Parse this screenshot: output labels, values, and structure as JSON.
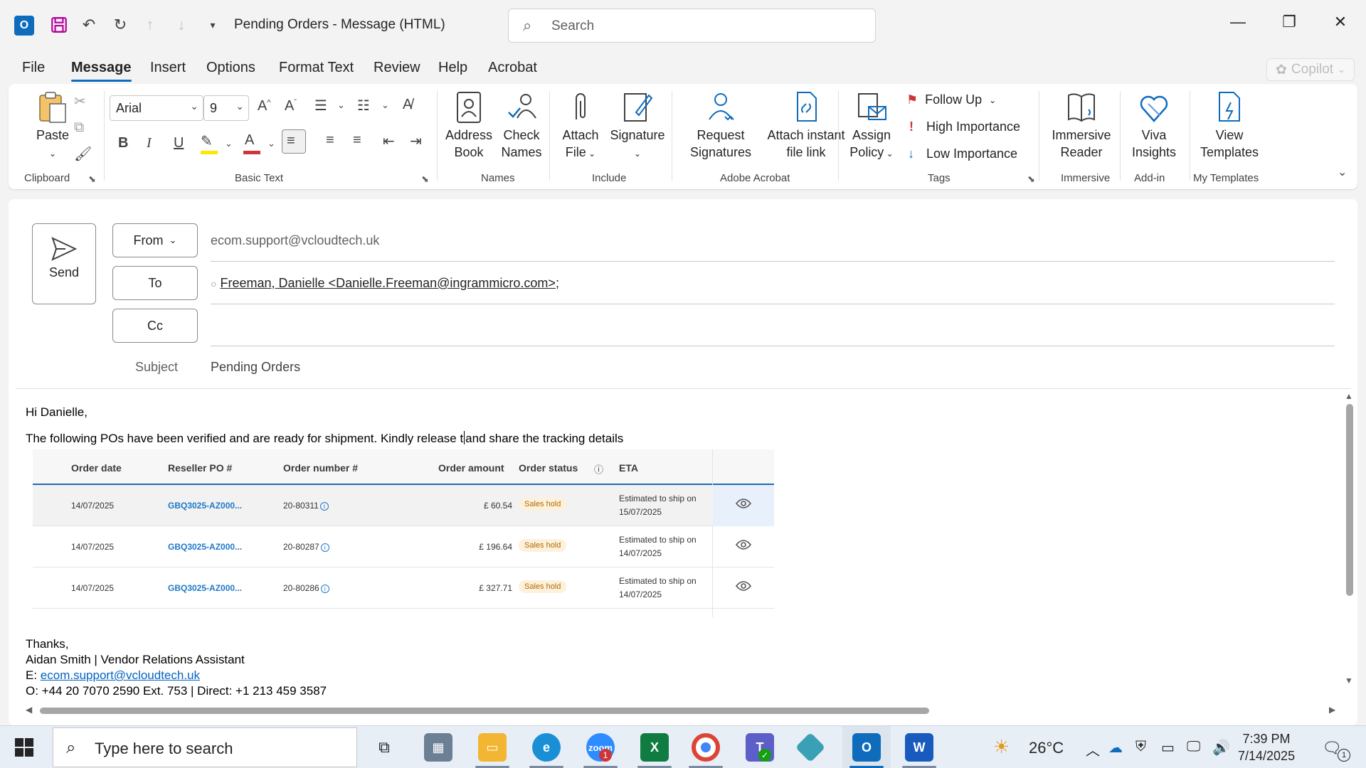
{
  "window": {
    "title": "Pending Orders  -  Message (HTML)",
    "search_placeholder": "Search"
  },
  "menu": {
    "tabs": [
      "File",
      "Message",
      "Insert",
      "Options",
      "Format Text",
      "Review",
      "Help",
      "Acrobat"
    ],
    "active": "Message",
    "copilot_label": "Copilot"
  },
  "ribbon": {
    "clipboard": {
      "paste": "Paste",
      "group": "Clipboard"
    },
    "basic_text": {
      "font": "Arial",
      "size": "9",
      "group": "Basic Text"
    },
    "names": {
      "address_book_1": "Address",
      "address_book_2": "Book",
      "check_names_1": "Check",
      "check_names_2": "Names",
      "group": "Names"
    },
    "include": {
      "attach_1": "Attach",
      "attach_2": "File",
      "signature": "Signature",
      "group": "Include"
    },
    "acrobat": {
      "request_1": "Request",
      "request_2": "Signatures",
      "attach_link_1": "Attach instant",
      "attach_link_2": "file link",
      "group": "Adobe Acrobat"
    },
    "tags": {
      "assign_1": "Assign",
      "assign_2": "Policy",
      "follow_up": "Follow Up",
      "high": "High Importance",
      "low": "Low Importance",
      "group": "Tags"
    },
    "immersive": {
      "reader_1": "Immersive",
      "reader_2": "Reader",
      "group": "Immersive"
    },
    "addin": {
      "viva_1": "Viva",
      "viva_2": "Insights",
      "group": "Add-in"
    },
    "templates": {
      "view_1": "View",
      "view_2": "Templates",
      "group": "My Templates"
    },
    "colors": {
      "highlight": "#ffe600",
      "font_color": "#d13438",
      "accent": "#0f6cbd"
    }
  },
  "compose": {
    "send_label": "Send",
    "from_label": "From",
    "from_value": "ecom.support@vcloudtech.uk",
    "to_label": "To",
    "to_value": "Freeman, Danielle <Danielle.Freeman@ingrammicro.com>",
    "to_sep": ";",
    "cc_label": "Cc",
    "subject_label": "Subject",
    "subject_value": "Pending Orders"
  },
  "body": {
    "greeting": "Hi Danielle,",
    "line1_before_caret": "The following POs have been verified and are ready for shipment. Kindly release t",
    "line1_after_caret": "and share the tracking details",
    "table": {
      "headers": [
        "Order date",
        "Reseller PO #",
        "Order number #",
        "Order amount",
        "Order status",
        "ETA"
      ],
      "rows": [
        {
          "date": "14/07/2025",
          "po": "GBQ3025-AZ000...",
          "order": "20-80311",
          "amount": "£ 60.54",
          "status": "Sales hold",
          "eta_1": "Estimated to ship on",
          "eta_2": "15/07/2025"
        },
        {
          "date": "14/07/2025",
          "po": "GBQ3025-AZ000...",
          "order": "20-80287",
          "amount": "£ 196.64",
          "status": "Sales hold",
          "eta_1": "Estimated to ship on",
          "eta_2": "14/07/2025"
        },
        {
          "date": "14/07/2025",
          "po": "GBQ3025-AZ000...",
          "order": "20-80286",
          "amount": "£ 327.71",
          "status": "Sales hold",
          "eta_1": "Estimated to ship on",
          "eta_2": "14/07/2025"
        }
      ]
    },
    "thanks": "Thanks,",
    "sig_name": "Aidan Smith | Vendor Relations Assistant",
    "sig_email_prefix": "E: ",
    "sig_email": "ecom.support@vcloudtech.uk",
    "sig_phone": "O:  +44 20 7070 2590 Ext. 753 | Direct: +1 213 459 3587"
  },
  "taskbar": {
    "search_placeholder": "Type here to search",
    "teams_badge": "1",
    "temperature": "26°C",
    "time": "7:39 PM",
    "date": "7/14/2025",
    "notif_count": "1"
  }
}
